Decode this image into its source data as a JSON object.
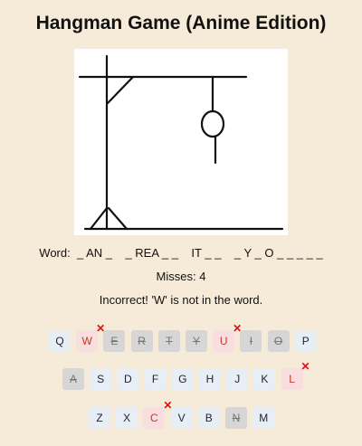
{
  "title": "Hangman Game (Anime Edition)",
  "word": {
    "label": "Word:",
    "display": "_ AN _    _ REA _ _    IT _ _    _ Y _ O _ _ _ _ _"
  },
  "misses": {
    "text": "Misses: 4",
    "count": 4
  },
  "message": "Incorrect! 'W' is not in the word.",
  "keyboard": {
    "rows": [
      [
        {
          "letter": "Q",
          "state": "available"
        },
        {
          "letter": "W",
          "state": "wrong"
        },
        {
          "letter": "E",
          "state": "used"
        },
        {
          "letter": "R",
          "state": "used"
        },
        {
          "letter": "T",
          "state": "used"
        },
        {
          "letter": "Y",
          "state": "used"
        },
        {
          "letter": "U",
          "state": "wrong"
        },
        {
          "letter": "I",
          "state": "used"
        },
        {
          "letter": "O",
          "state": "used"
        },
        {
          "letter": "P",
          "state": "available"
        }
      ],
      [
        {
          "letter": "A",
          "state": "used"
        },
        {
          "letter": "S",
          "state": "available"
        },
        {
          "letter": "D",
          "state": "available"
        },
        {
          "letter": "F",
          "state": "available"
        },
        {
          "letter": "G",
          "state": "available"
        },
        {
          "letter": "H",
          "state": "available"
        },
        {
          "letter": "J",
          "state": "available"
        },
        {
          "letter": "K",
          "state": "available"
        },
        {
          "letter": "L",
          "state": "wrong"
        }
      ],
      [
        {
          "letter": "Z",
          "state": "available"
        },
        {
          "letter": "X",
          "state": "available"
        },
        {
          "letter": "C",
          "state": "wrong"
        },
        {
          "letter": "V",
          "state": "available"
        },
        {
          "letter": "B",
          "state": "available"
        },
        {
          "letter": "N",
          "state": "used"
        },
        {
          "letter": "M",
          "state": "available"
        }
      ]
    ]
  },
  "colors": {
    "background": "#f6ead9",
    "key": "#e8eef6",
    "key_used": "#d6d6d6",
    "key_wrong": "#f8dede",
    "wrong_mark": "#dd1111"
  }
}
